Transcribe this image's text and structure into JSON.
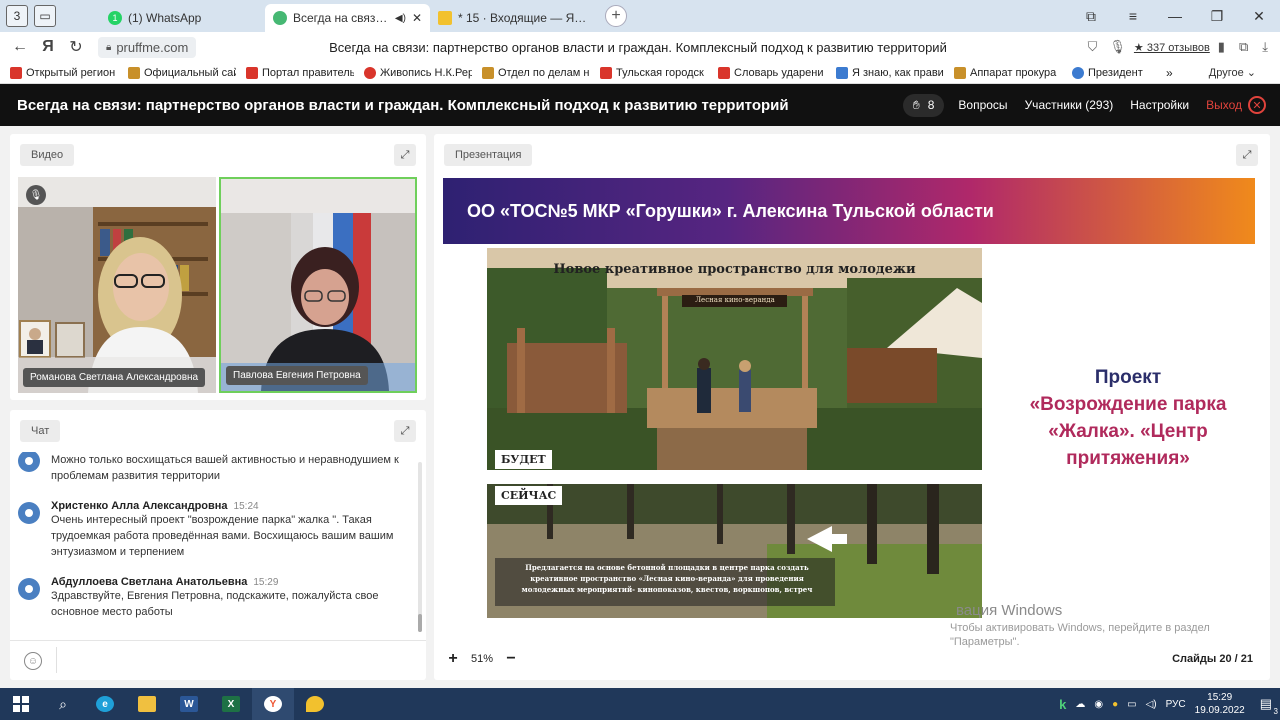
{
  "browser": {
    "tab_counter": "3",
    "tabs": [
      {
        "title": "(1) WhatsApp",
        "color": "#25d366",
        "glyph": "1"
      },
      {
        "title": "Всегда на связи: пар",
        "color": "#46b873",
        "glyph": "",
        "active": true
      },
      {
        "title": "* 15 · Входящие — Яндекс",
        "color": "#f2c12e",
        "glyph": ""
      }
    ],
    "domain": "pruffme.com",
    "page_title": "Всегда на связи: партнерство органов власти и граждан. Комплексный подход к развитию территорий",
    "reviews": "★ 337 отзывов",
    "bookmarks": [
      {
        "label": "Открытый регион",
        "color": "#d9352b"
      },
      {
        "label": "Официальный сай",
        "color": "#c8902a"
      },
      {
        "label": "Портал правитель",
        "color": "#d9352b"
      },
      {
        "label": "Живопись Н.К.Рер",
        "color": "#d9352b"
      },
      {
        "label": "Отдел по делам н",
        "color": "#c8902a"
      },
      {
        "label": "Тульская городск",
        "color": "#d9352b"
      },
      {
        "label": "Словарь ударени",
        "color": "#d9352b"
      },
      {
        "label": "Я знаю, как прави",
        "color": "#3c7bd0"
      },
      {
        "label": "Аппарат прокура",
        "color": "#c8902a"
      },
      {
        "label": "Президент",
        "color": "#3c7bd0"
      }
    ],
    "bookmarks_more": "»",
    "bookmarks_other": "Другое"
  },
  "header": {
    "title": "Всегда на связи: партнерство органов власти и граждан. Комплексный подход к развитию территорий",
    "hand_count": "8",
    "questions": "Вопросы",
    "participants": "Участники (293)",
    "settings": "Настройки",
    "exit": "Выход"
  },
  "video": {
    "label": "Видео",
    "participants": [
      {
        "name": "Романова Светлана Александровна"
      },
      {
        "name": "Павлова Евгения Петровна"
      }
    ]
  },
  "chat": {
    "label": "Чат",
    "messages": [
      {
        "author": "",
        "time": "",
        "text": "Можно только восхищаться вашей активностью и неравнодушием к проблемам развития территории"
      },
      {
        "author": "Христенко Алла Александровна",
        "time": "15:24",
        "text": "Очень интересный проект \"возрождение парка\" жалка \". Такая трудоемкая работа проведённая вами. Восхищаюсь вашим вашим энтузиазмом и терпением"
      },
      {
        "author": "Абдуллоева Светлана Анатольевна",
        "time": "15:29",
        "text": "Здравствуйте, Евгения Петровна, подскажите, пожалуйста свое основное место работы"
      }
    ]
  },
  "presentation": {
    "label": "Презентация",
    "banner": "ОО «ТОС№5 МКР «Горушки» г. Алексина Тульской области",
    "top_caption": "Новое креативное пространство для молодежи",
    "sign": "Лесная кино-веранда",
    "label_future": "БУДЕТ",
    "label_now": "СЕЙЧАС",
    "bottom_text": "Предлагается на основе бетонной площадки в центре парка создать креативное пространство «Лесная кино-веранда» для проведения молодежных мероприятий- кинопоказов, квестов, воркшопов, встреч",
    "project_line1": "Проект",
    "project_line2": "«Возрождение парка «Жалка». «Центр притяжения»",
    "zoom": "51%",
    "slides": "Слайды 20 / 21"
  },
  "watermark": {
    "line1": "вация Windows",
    "line2": "Чтобы активировать Windows, перейдите в раздел",
    "line3": "\"Параметры\"."
  },
  "taskbar": {
    "lang": "РУС",
    "time": "15:29",
    "date": "19.09.2022",
    "notif": "3"
  }
}
